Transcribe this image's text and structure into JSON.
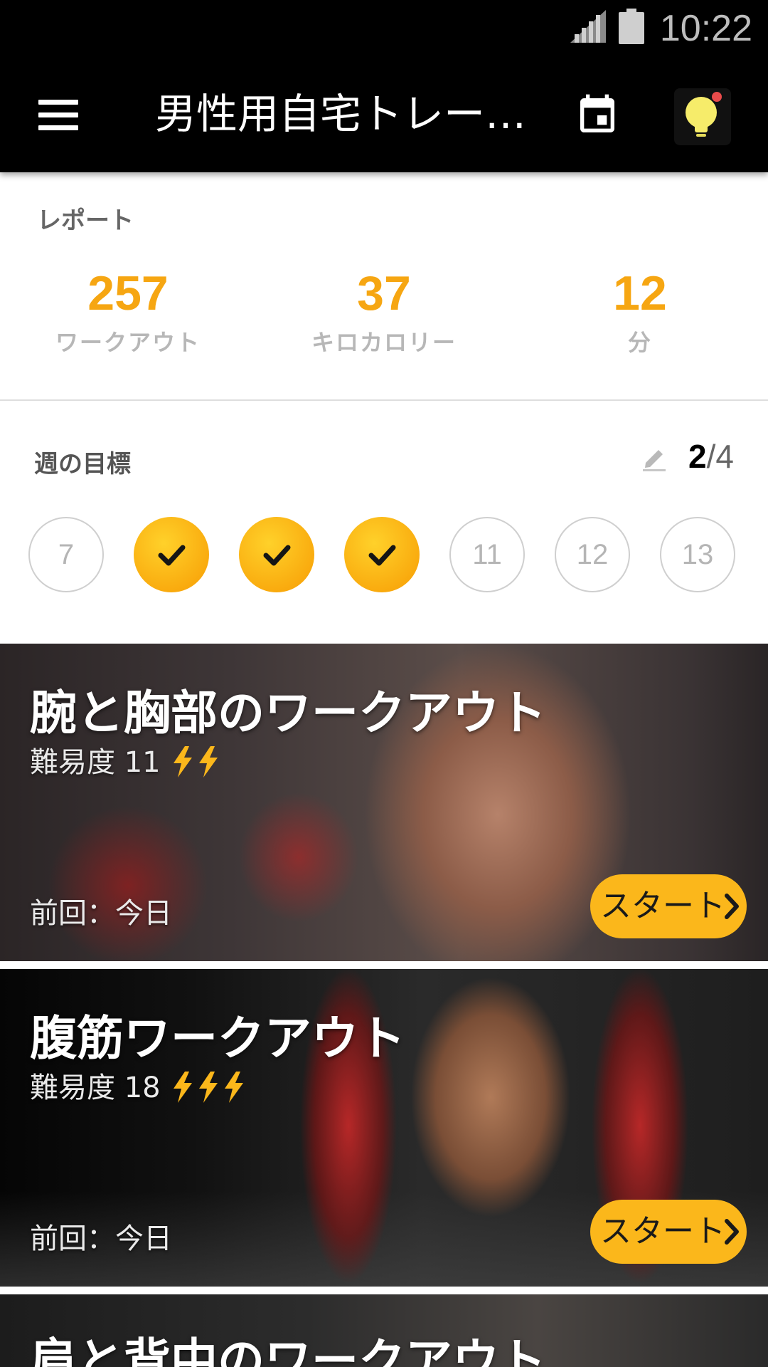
{
  "status_bar": {
    "time": "10:22"
  },
  "toolbar": {
    "title": "男性用自宅トレー…"
  },
  "report": {
    "label": "レポート",
    "stats": [
      {
        "value": "257",
        "label": "ワークアウト"
      },
      {
        "value": "37",
        "label": "キロカロリー"
      },
      {
        "value": "12",
        "label": "分"
      }
    ]
  },
  "weekly_goal": {
    "label": "週の目標",
    "done": "2",
    "separator": "/",
    "total": "4",
    "days": [
      {
        "label": "7",
        "done": false
      },
      {
        "label": "",
        "done": true
      },
      {
        "label": "",
        "done": true
      },
      {
        "label": "",
        "done": true
      },
      {
        "label": "11",
        "done": false
      },
      {
        "label": "12",
        "done": false
      },
      {
        "label": "13",
        "done": false
      }
    ]
  },
  "workouts": [
    {
      "title": "腕と胸部のワークアウト",
      "difficulty": "難易度 11",
      "level": 2,
      "last": "前回：今日",
      "start": "スタート"
    },
    {
      "title": "腹筋ワークアウト",
      "difficulty": "難易度 18",
      "level": 3,
      "last": "前回：今日",
      "start": "スタート"
    },
    {
      "title": "肩と背中のワークアウト"
    }
  ],
  "colors": {
    "accent": "#f6a612",
    "button": "#fbb71b",
    "toolbar": "#000000"
  },
  "icons": {
    "menu": "menu-icon",
    "calendar": "calendar-icon",
    "tips": "lightbulb-icon",
    "edit": "pencil-icon",
    "check": "check-icon",
    "difficulty": "lightning-icon",
    "next": "chevron-right-icon"
  }
}
